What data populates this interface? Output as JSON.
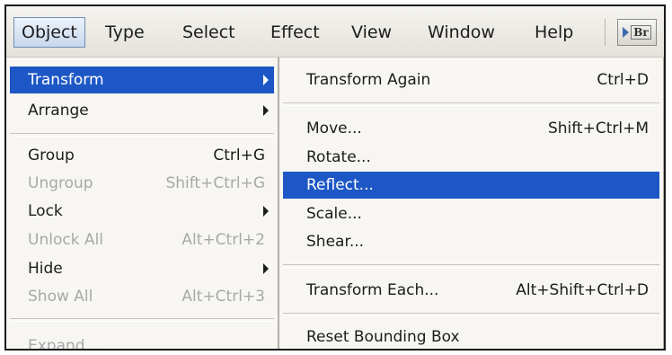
{
  "menubar": {
    "items": [
      "Object",
      "Type",
      "Select",
      "Effect",
      "View",
      "Window",
      "Help"
    ],
    "active_index": 0,
    "bridge_button": "Br"
  },
  "object_menu": {
    "items": [
      {
        "label": "Transform",
        "shortcut": "",
        "submenu": true,
        "highlighted": true,
        "enabled": true
      },
      {
        "label": "Arrange",
        "shortcut": "",
        "submenu": true,
        "highlighted": false,
        "enabled": true
      },
      {
        "label": "Group",
        "shortcut": "Ctrl+G",
        "submenu": false,
        "highlighted": false,
        "enabled": true
      },
      {
        "label": "Ungroup",
        "shortcut": "Shift+Ctrl+G",
        "submenu": false,
        "highlighted": false,
        "enabled": false
      },
      {
        "label": "Lock",
        "shortcut": "",
        "submenu": true,
        "highlighted": false,
        "enabled": true
      },
      {
        "label": "Unlock All",
        "shortcut": "Alt+Ctrl+2",
        "submenu": false,
        "highlighted": false,
        "enabled": false
      },
      {
        "label": "Hide",
        "shortcut": "",
        "submenu": true,
        "highlighted": false,
        "enabled": true
      },
      {
        "label": "Show All",
        "shortcut": "Alt+Ctrl+3",
        "submenu": false,
        "highlighted": false,
        "enabled": false
      },
      {
        "label": "Expand...",
        "shortcut": "",
        "submenu": false,
        "highlighted": false,
        "enabled": false
      }
    ]
  },
  "transform_submenu": {
    "items": [
      {
        "label": "Transform Again",
        "shortcut": "Ctrl+D",
        "highlighted": false
      },
      {
        "label": "Move...",
        "shortcut": "Shift+Ctrl+M",
        "highlighted": false
      },
      {
        "label": "Rotate...",
        "shortcut": "",
        "highlighted": false
      },
      {
        "label": "Reflect...",
        "shortcut": "",
        "highlighted": true
      },
      {
        "label": "Scale...",
        "shortcut": "",
        "highlighted": false
      },
      {
        "label": "Shear...",
        "shortcut": "",
        "highlighted": false
      },
      {
        "label": "Transform Each...",
        "shortcut": "Alt+Shift+Ctrl+D",
        "highlighted": false
      },
      {
        "label": "Reset Bounding Box",
        "shortcut": "",
        "highlighted": false
      }
    ]
  }
}
